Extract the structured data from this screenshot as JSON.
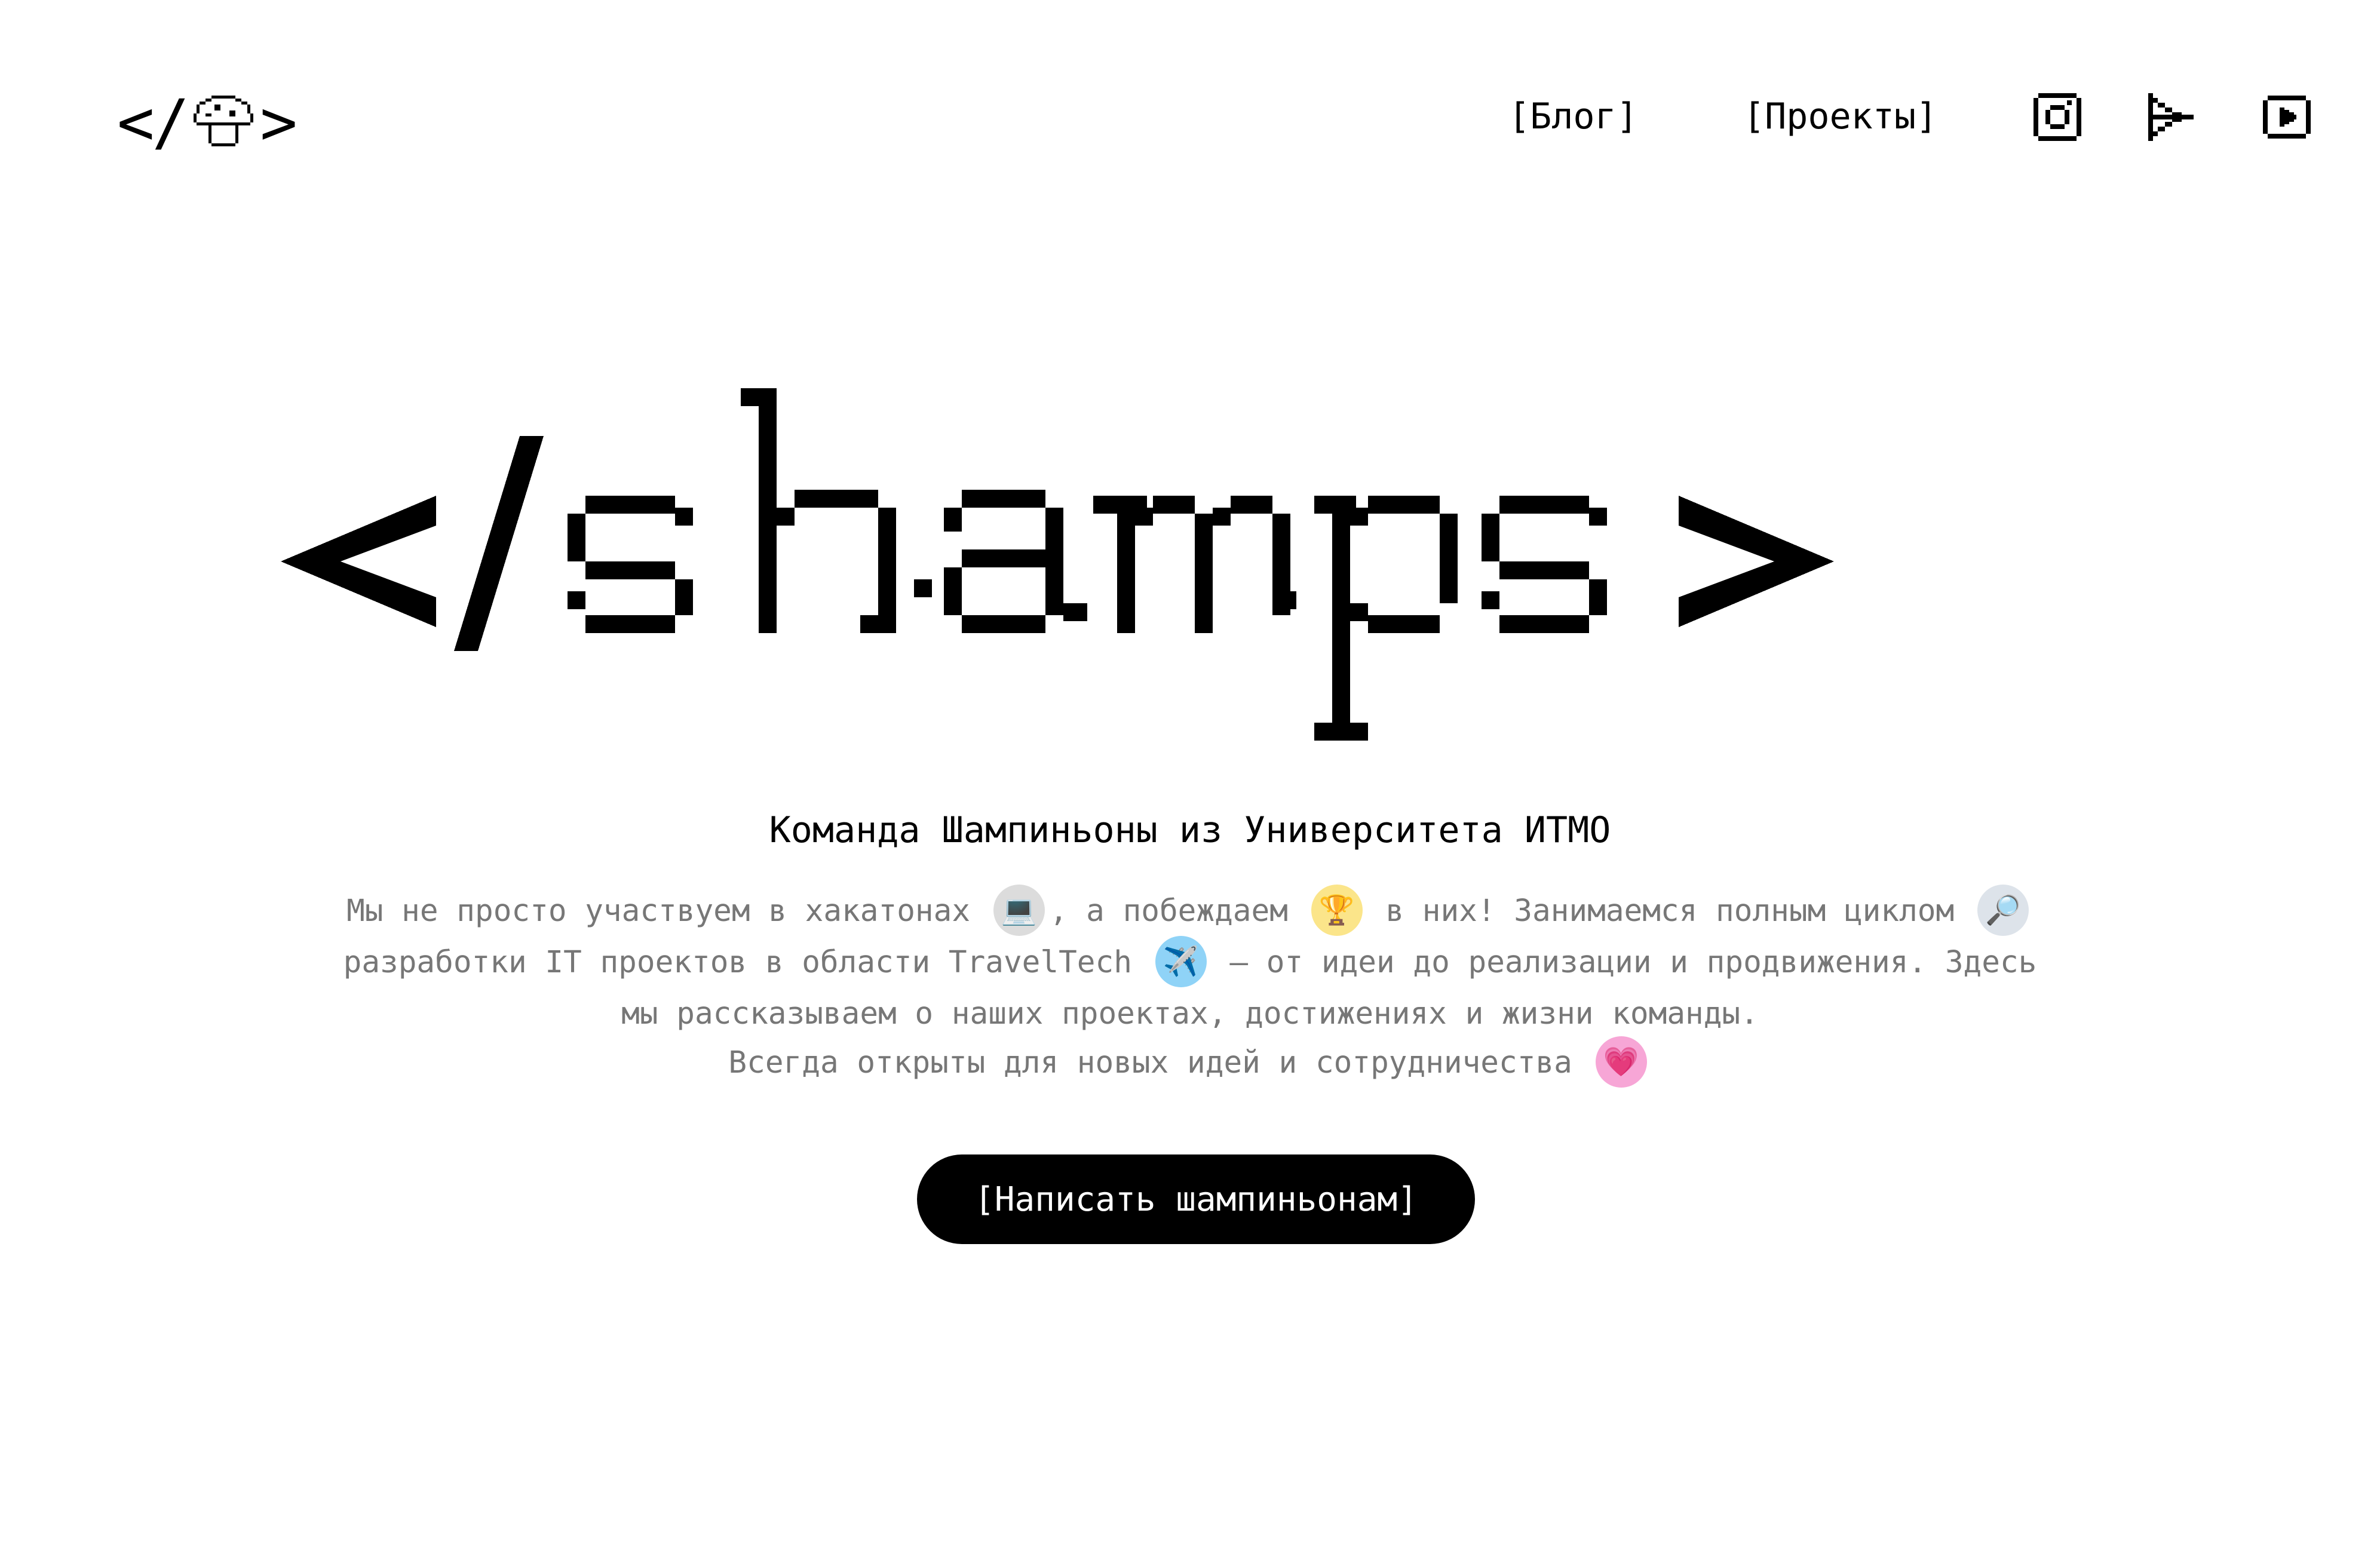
{
  "header": {
    "logo_left": "</",
    "logo_right": ">",
    "logo_icon": "mushroom-icon",
    "nav": [
      {
        "label": "[Блог]"
      },
      {
        "label": "[Проекты]"
      }
    ],
    "social": [
      {
        "name": "instagram-icon"
      },
      {
        "name": "telegram-icon"
      },
      {
        "name": "youtube-icon"
      }
    ]
  },
  "hero": {
    "title": "</shamps>",
    "subtitle": "Команда Шампиньоны из Университета ИТМО",
    "description": {
      "part1": "Мы не просто участвуем в хакатонах",
      "emoji1": "💻",
      "part2": ", а побеждаем",
      "emoji2": "🏆",
      "part3": "в них! Занимаемся полным циклом",
      "emoji3": "🔎",
      "part4": "разработки IT проектов в области TravelTech",
      "emoji4": "✈️",
      "part5": "— от идеи до реализации и продвижения. Здесь мы рассказываем о наших проектах, достижениях и жизни команды.",
      "part6": "Всегда открыты для новых идей и сотрудничества",
      "emoji5": "💗"
    },
    "cta_label": "[Написать шампиньонам]"
  },
  "colors": {
    "background": "#ffffff",
    "text": "#000000",
    "muted_text": "#777777",
    "button_bg": "#000000",
    "button_text": "#ffffff"
  }
}
